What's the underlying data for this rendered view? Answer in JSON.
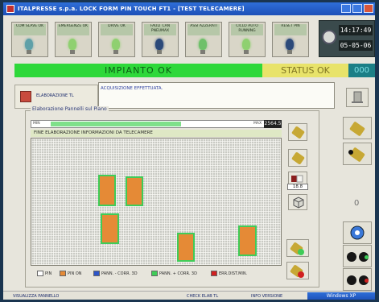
{
  "window": {
    "title": "ITALPRESSE s.p.a. LOCK FORM PIN TOUCH FT1 - [TEST TELECAMERE]"
  },
  "status_buttons": [
    {
      "label": "COM SLAVE OK",
      "lamp": "#5fa0a8"
    },
    {
      "label": "EMERGENZE OK",
      "lamp": "#8fd070"
    },
    {
      "label": "DRIVE OK",
      "lamp": "#8fd070"
    },
    {
      "label": "FAULT CAN PNEUMAX",
      "lamp": "#2c4a7a"
    },
    {
      "label": "ASSI AZZERATI",
      "lamp": "#6fc06a"
    },
    {
      "label": "CICLO AUTO RUNNING",
      "lamp": "#8fd070"
    },
    {
      "label": "RESET PIN",
      "lamp": "#2c4a7a"
    }
  ],
  "clock": {
    "time": "14:17:49",
    "date": "05-05-06"
  },
  "plant_status": "IMPIANTO OK",
  "status_text": "STATUS OK",
  "status_code": "000",
  "camera_tab": {
    "label": "ELABORAZIONE TL"
  },
  "message": "ACQUISIZIONE EFFETTUATA.",
  "group_title": "Elaborazione Pannelli sul Piano",
  "progress": {
    "min_label": "MIN",
    "max_label": "MAX",
    "value": "2564.5",
    "fraction": 0.62
  },
  "banner": "FINE ELABORAZIONE INFORMAZIONI DA TELECAMERE",
  "side_value": "18.8",
  "legend": [
    {
      "label": "PIN",
      "color": "#ffffff"
    },
    {
      "label": "PIN ON",
      "color": "#e58a36"
    },
    {
      "label": "PANN. - CORR. 3D",
      "color": "#2d55c8"
    },
    {
      "label": "PANN. + CORR. 3D",
      "color": "#3fcc58"
    },
    {
      "label": "ERR.DIST.MIN.",
      "color": "#d02020"
    }
  ],
  "right_zero": "0",
  "bottom": {
    "visualizza": "VISUALIZZA PANNELLO",
    "check": "CHECK ELAB TL",
    "info": "INFO VERSIONE",
    "taskbar": "Windows XP"
  }
}
